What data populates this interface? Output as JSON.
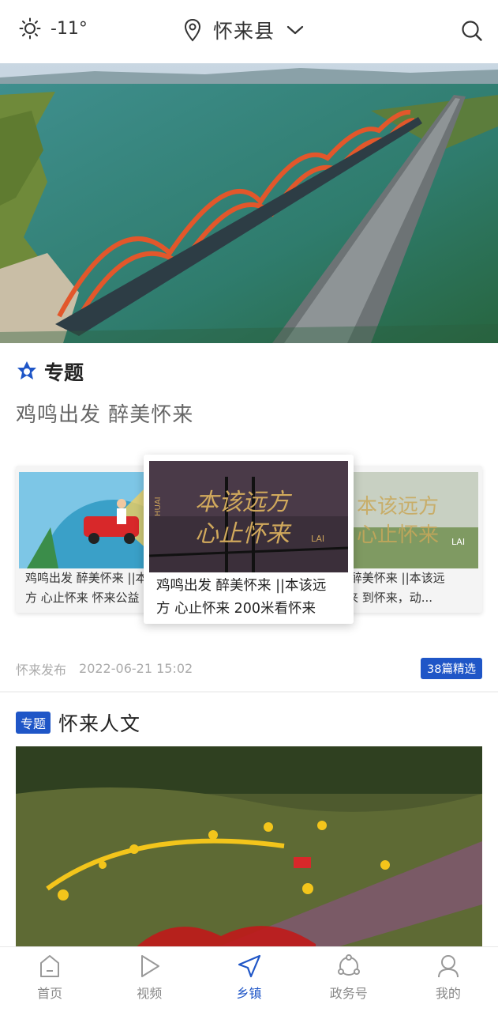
{
  "header": {
    "weather_icon": "sun-icon",
    "temperature": "-11°",
    "location": "怀来县",
    "location_icon": "map-pin-icon",
    "dropdown_icon": "chevron-down-icon",
    "search_icon": "search-icon"
  },
  "topic": {
    "icon": "star-badge-icon",
    "label": "专题",
    "subtitle": "鸡鸣出发 醉美怀来",
    "cards": [
      {
        "caption_line1": "鸡鸣出发 醉美怀来 ||本",
        "caption_line2": "方 心止怀来 怀来公益"
      },
      {
        "caption_line1": "鸡鸣出发 醉美怀来 ||本该远",
        "caption_line2": "方 心止怀来 200米看怀来",
        "overlay_line1": "本该远方",
        "overlay_line2": "心止怀来",
        "overlay_side": "HUAI",
        "overlay_lai": "LAI"
      },
      {
        "caption_line1": "发 醉美怀来 ||本该远",
        "caption_line2": "怀来  到怀来，动...",
        "overlay_line1": "本该远方",
        "overlay_line2": "心止怀来",
        "overlay_lai": "LAI"
      }
    ],
    "source": "怀来发布",
    "time": "2022-06-21 15:02",
    "count_badge": "38篇精选"
  },
  "culture": {
    "tag": "专题",
    "title": "怀来人文"
  },
  "nav": {
    "items": [
      {
        "label": "首页",
        "icon": "home-icon"
      },
      {
        "label": "视频",
        "icon": "play-icon"
      },
      {
        "label": "乡镇",
        "icon": "navigation-arrow-icon",
        "active": true
      },
      {
        "label": "政务号",
        "icon": "share-network-icon"
      },
      {
        "label": "我的",
        "icon": "user-icon"
      }
    ]
  },
  "colors": {
    "accent": "#1f56c7",
    "text": "#222222",
    "muted": "#aaaaaa"
  }
}
